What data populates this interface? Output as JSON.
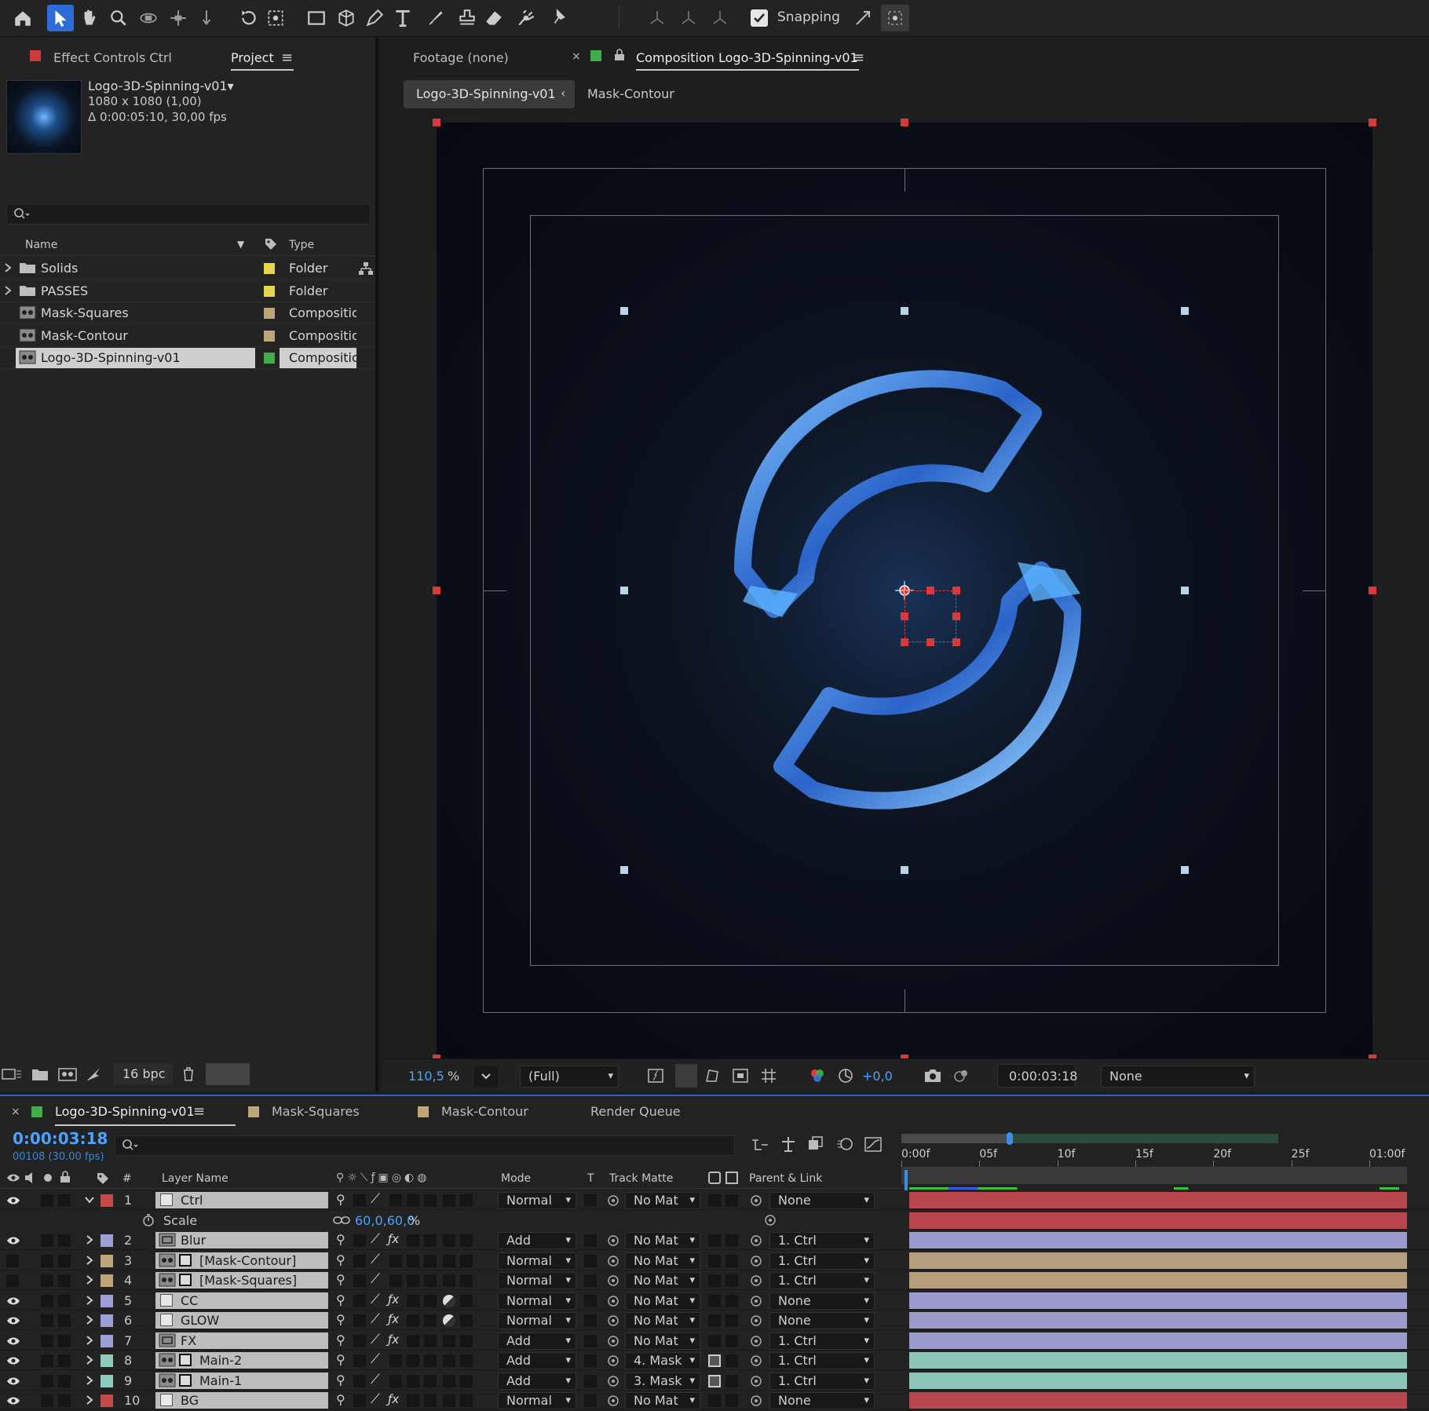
{
  "toolbar": {
    "tools": [
      "home-icon",
      "selection-arrow-icon",
      "hand-icon",
      "zoom-icon",
      "orbit-camera-icon",
      "pan-camera-icon",
      "dolly-camera-icon",
      "rotate-icon",
      "pan-behind-icon",
      "rectangle-icon",
      "cube-icon",
      "pen-icon",
      "type-icon",
      "brush-icon",
      "clone-stamp-icon",
      "eraser-icon",
      "roto-brush-icon",
      "puppet-pin-icon"
    ],
    "snapping_label": "Snapping",
    "snapping_checked": true
  },
  "project_panel": {
    "tab_effect_controls": "Effect Controls Ctrl",
    "tab_project": "Project",
    "selected_item_name": "Logo-3D-Spinning-v01▾",
    "selected_item_res": "1080 x 1080 (1,00)",
    "selected_item_duration": "Δ 0:00:05:10, 30,00 fps",
    "col_name": "Name",
    "col_type": "Type",
    "items": [
      {
        "name": "Solids",
        "type": "Folder",
        "color": "#e8d44d",
        "kind": "folder",
        "expandable": true
      },
      {
        "name": "PASSES",
        "type": "Folder",
        "color": "#e8d44d",
        "kind": "folder",
        "expandable": true
      },
      {
        "name": "Mask-Squares",
        "type": "Composition",
        "color": "#bfa57a",
        "kind": "comp",
        "expandable": false
      },
      {
        "name": "Mask-Contour",
        "type": "Composition",
        "color": "#bfa57a",
        "kind": "comp",
        "expandable": false
      },
      {
        "name": "Logo-3D-Spinning-v01",
        "type": "Composition",
        "color": "#3fae49",
        "kind": "comp",
        "expandable": false,
        "selected": true
      }
    ],
    "bit_depth": "16 bpc"
  },
  "viewer": {
    "tab_footage": "Footage (none)",
    "tab_composition": "Composition Logo-3D-Spinning-v01",
    "breadcrumb_active": "Logo-3D-Spinning-v01",
    "breadcrumb_next": "Mask-Contour",
    "zoom_value": "110,5",
    "zoom_unit": "%",
    "resolution": "(Full)",
    "exposure": "+0,0",
    "timecode": "0:00:03:18",
    "camera": "None"
  },
  "timeline": {
    "tabs": [
      {
        "label": "Logo-3D-Spinning-v01",
        "color": "#3fae49",
        "active": true
      },
      {
        "label": "Mask-Squares",
        "color": "#bfa57a"
      },
      {
        "label": "Mask-Contour",
        "color": "#bfa57a"
      },
      {
        "label": "Render Queue",
        "color": ""
      }
    ],
    "current_time": "0:00:03:18",
    "current_frame": "00108 (30.00 fps)",
    "col_layer_name": "Layer Name",
    "col_mode": "Mode",
    "col_t": "T",
    "col_track_matte": "Track Matte",
    "col_parent": "Parent & Link",
    "col_hash": "#",
    "ruler": [
      "0:00f",
      "05f",
      "10f",
      "15f",
      "20f",
      "25f",
      "01:00f"
    ],
    "playhead_fraction": 0.2,
    "scale_property": {
      "label": "Scale",
      "value": "60,0,60,0",
      "unit": "%"
    },
    "layers": [
      {
        "num": "1",
        "name": "Ctrl",
        "color": "#c44a4a",
        "mode": "Normal",
        "matte": "No Mat",
        "parent": "None",
        "eye": true,
        "fx": false,
        "expanded": true,
        "bar": "#b8454b",
        "icon": "solid"
      },
      {
        "num": "2",
        "name": "Blur",
        "color": "#9e9fd6",
        "mode": "Add",
        "matte": "No Mat",
        "parent": "1. Ctrl",
        "eye": true,
        "fx": true,
        "bar": "#9a9bcc",
        "icon": "adjust"
      },
      {
        "num": "3",
        "name": "[Mask-Contour]",
        "color": "#bfa57a",
        "mode": "Normal",
        "matte": "No Mat",
        "parent": "1. Ctrl",
        "eye": false,
        "fx": false,
        "bar": "#b59f7c",
        "icon": "comp"
      },
      {
        "num": "4",
        "name": "[Mask-Squares]",
        "color": "#bfa57a",
        "mode": "Normal",
        "matte": "No Mat",
        "parent": "1. Ctrl",
        "eye": false,
        "fx": false,
        "bar": "#b59f7c",
        "icon": "comp"
      },
      {
        "num": "5",
        "name": "CC",
        "color": "#9e9fd6",
        "mode": "Normal",
        "matte": "No Mat",
        "parent": "None",
        "eye": true,
        "fx": true,
        "bar": "#9a9bcc",
        "icon": "solid"
      },
      {
        "num": "6",
        "name": "GLOW",
        "color": "#9e9fd6",
        "mode": "Normal",
        "matte": "No Mat",
        "parent": "None",
        "eye": true,
        "fx": true,
        "bar": "#9a9bcc",
        "icon": "solid"
      },
      {
        "num": "7",
        "name": "FX",
        "color": "#9e9fd6",
        "mode": "Add",
        "matte": "No Mat",
        "parent": "1. Ctrl",
        "eye": true,
        "fx": true,
        "bar": "#9a9bcc",
        "icon": "adjust"
      },
      {
        "num": "8",
        "name": "Main-2",
        "color": "#8fcbbd",
        "mode": "Add",
        "matte": "4. Mask",
        "parent": "1. Ctrl",
        "eye": true,
        "fx": false,
        "bar": "#8ec4b6",
        "icon": "comp"
      },
      {
        "num": "9",
        "name": "Main-1",
        "color": "#8fcbbd",
        "mode": "Add",
        "matte": "3. Mask",
        "parent": "1. Ctrl",
        "eye": true,
        "fx": false,
        "bar": "#8ec4b6",
        "icon": "comp"
      },
      {
        "num": "10",
        "name": "BG",
        "color": "#c44a4a",
        "mode": "Normal",
        "matte": "No Mat",
        "parent": "None",
        "eye": true,
        "fx": true,
        "bar": "#b8454b",
        "icon": "solid"
      }
    ]
  }
}
